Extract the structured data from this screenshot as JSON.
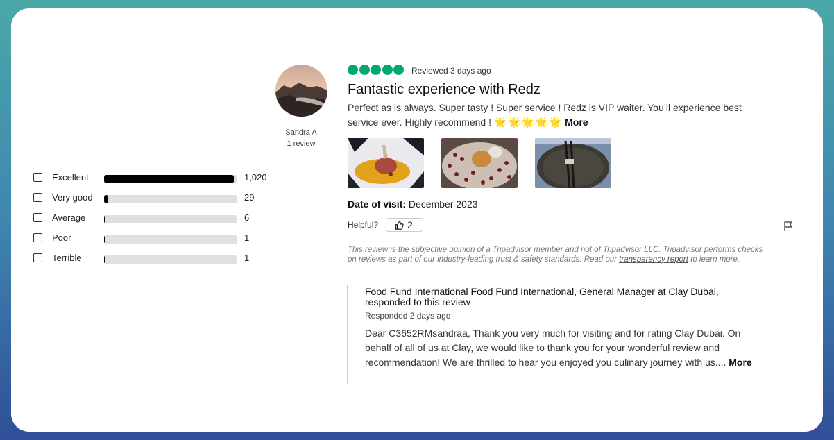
{
  "ratings": [
    {
      "label": "Excellent",
      "count": "1,020",
      "fraction": 0.976
    },
    {
      "label": "Very good",
      "count": "29",
      "fraction": 0.03
    },
    {
      "label": "Average",
      "count": "6",
      "fraction": 0.006
    },
    {
      "label": "Poor",
      "count": "1",
      "fraction": 0.001
    },
    {
      "label": "Terrible",
      "count": "1",
      "fraction": 0.001
    }
  ],
  "reviewer": {
    "name": "Sandra A",
    "reviews": "1 review"
  },
  "review": {
    "rating": 5,
    "bubble_color": "#00aa6c",
    "reviewed": "Reviewed 3 days ago",
    "title": "Fantastic experience with Redz",
    "body": "Perfect as is always. Super tasty ! Super service ! Redz is VIP waiter. You’ll experience best service ever. Highly recommend !",
    "body_emoji": "🌟🌟🌟🌟🌟",
    "more": "More",
    "photos": [
      "photo-dish-1",
      "photo-dish-2",
      "photo-dish-3"
    ],
    "date_label": "Date of visit:",
    "date_value": "December 2023",
    "helpful_label": "Helpful?",
    "helpful_count": "2",
    "disclaimer_pre": "This review is the subjective opinion of a Tripadvisor member and not of Tripadvisor LLC. Tripadvisor performs checks on reviews as part of our industry-leading trust & safety standards. Read our",
    "disclaimer_link": "transparency report",
    "disclaimer_post": "to learn more."
  },
  "response": {
    "heading": "Food Fund International Food Fund International, General Manager at Clay Dubai, responded to this review",
    "date": "Responded 2 days ago",
    "body": "Dear C3652RMsandraa, Thank you very much for visiting and for rating Clay Dubai. On behalf of all of us at Clay, we would like to thank you for your wonderful review and recommendation! We are thrilled to hear you enjoyed you culinary journey with us....",
    "more": "More"
  }
}
